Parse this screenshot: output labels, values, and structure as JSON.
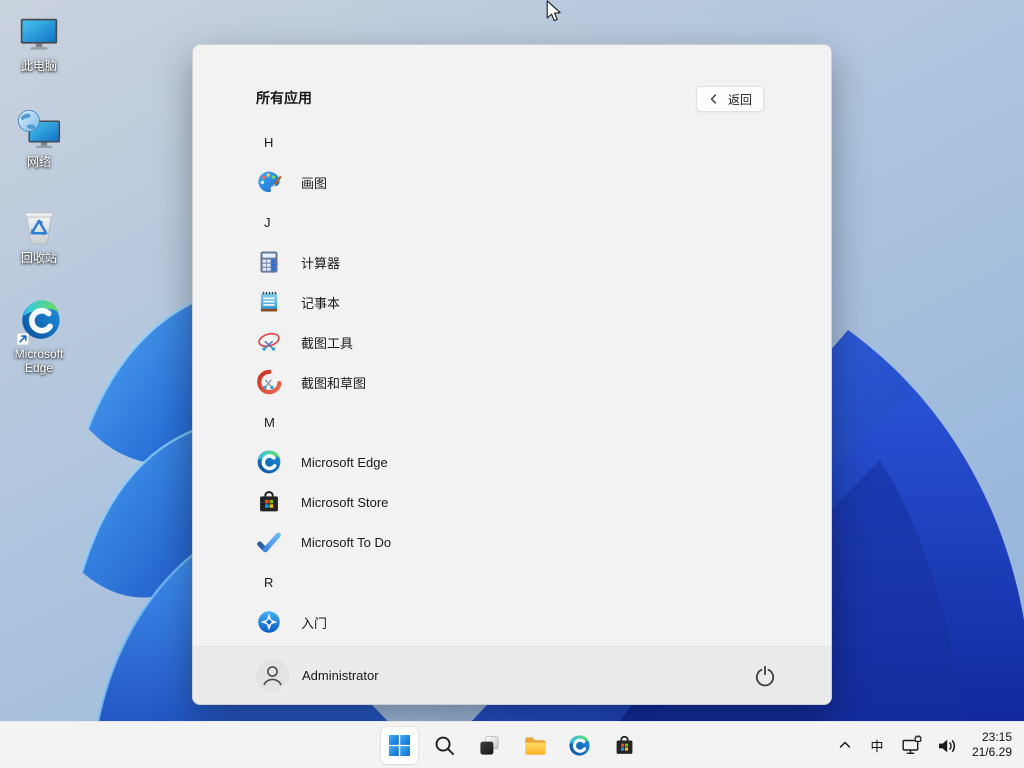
{
  "desktop": {
    "icons": [
      {
        "name": "this-pc",
        "label": "此电脑"
      },
      {
        "name": "network",
        "label": "网络"
      },
      {
        "name": "recycle-bin",
        "label": "回收站"
      },
      {
        "name": "microsoft-edge",
        "label": "Microsoft Edge"
      }
    ]
  },
  "start_menu": {
    "title": "所有应用",
    "back_button": {
      "label": "返回"
    },
    "rows": [
      {
        "type": "section",
        "label": "H"
      },
      {
        "type": "app",
        "icon": "paint-icon",
        "label": "画图"
      },
      {
        "type": "section",
        "label": "J"
      },
      {
        "type": "app",
        "icon": "calculator-icon",
        "label": "计算器"
      },
      {
        "type": "app",
        "icon": "notepad-icon",
        "label": "记事本"
      },
      {
        "type": "app",
        "icon": "snipping-tool-icon",
        "label": "截图工具"
      },
      {
        "type": "app",
        "icon": "snip-sketch-icon",
        "label": "截图和草图"
      },
      {
        "type": "section",
        "label": "M"
      },
      {
        "type": "app",
        "icon": "edge-icon",
        "label": "Microsoft Edge"
      },
      {
        "type": "app",
        "icon": "store-icon",
        "label": "Microsoft Store"
      },
      {
        "type": "app",
        "icon": "todo-icon",
        "label": "Microsoft To Do"
      },
      {
        "type": "section",
        "label": "R"
      },
      {
        "type": "app",
        "icon": "get-started-icon",
        "label": "入门"
      }
    ],
    "footer": {
      "user": "Administrator"
    }
  },
  "taskbar": {
    "buttons": [
      "start",
      "search",
      "task-view",
      "file-explorer",
      "edge",
      "store"
    ],
    "tray": {
      "ime": "中",
      "time": "23:15",
      "date": "21/6.29"
    }
  },
  "colors": {
    "panel_bg": "#f2f2f2",
    "footer_bg": "#ebebeb",
    "taskbar_bg": "#f3f3f3",
    "bloom_dark": "#16309e",
    "bloom_bright": "#2f86e8",
    "ms_red": "#f25022",
    "ms_green": "#7fba00",
    "ms_blue": "#00a4ef",
    "ms_yellow": "#ffb900"
  }
}
